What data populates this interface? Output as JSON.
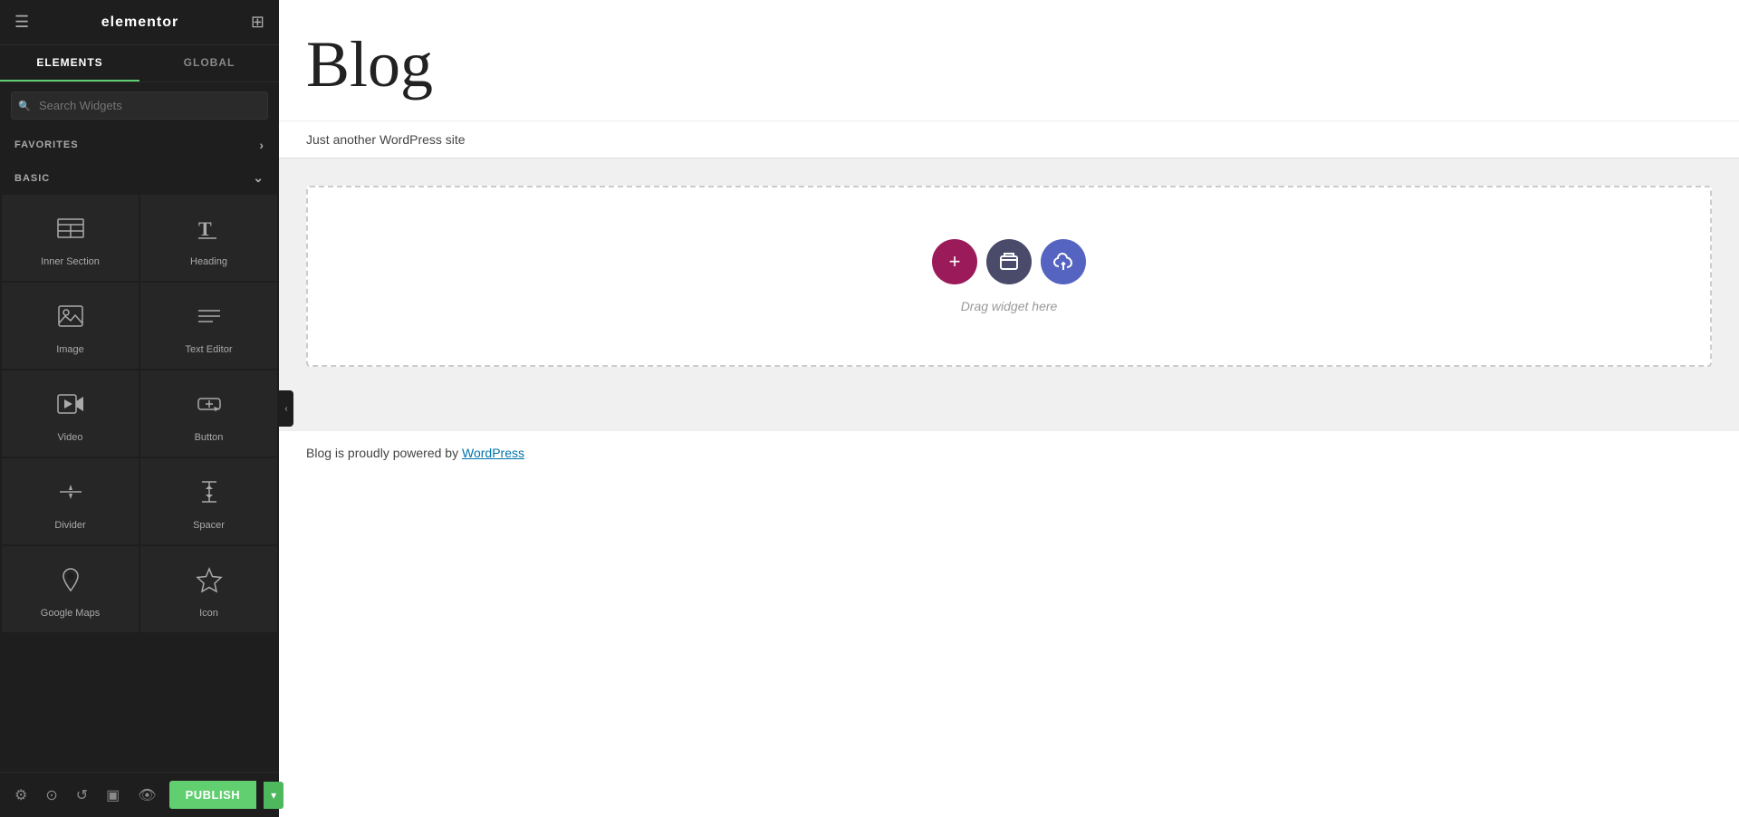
{
  "sidebar": {
    "logo": "elementor",
    "menu_icon": "☰",
    "grid_icon": "⊞",
    "tabs": [
      {
        "id": "elements",
        "label": "ELEMENTS",
        "active": true
      },
      {
        "id": "global",
        "label": "GLOBAL",
        "active": false
      }
    ],
    "search_placeholder": "Search Widgets",
    "sections": [
      {
        "id": "favorites",
        "label": "FAVORITES",
        "collapsed": false,
        "arrow": "›"
      },
      {
        "id": "basic",
        "label": "BASIC",
        "collapsed": false,
        "arrow": "⌄"
      }
    ],
    "widgets": [
      {
        "id": "inner-section",
        "label": "Inner Section",
        "icon": "inner-section"
      },
      {
        "id": "heading",
        "label": "Heading",
        "icon": "heading"
      },
      {
        "id": "image",
        "label": "Image",
        "icon": "image"
      },
      {
        "id": "text-editor",
        "label": "Text Editor",
        "icon": "text-editor"
      },
      {
        "id": "video",
        "label": "Video",
        "icon": "video"
      },
      {
        "id": "button",
        "label": "Button",
        "icon": "button"
      },
      {
        "id": "divider",
        "label": "Divider",
        "icon": "divider"
      },
      {
        "id": "spacer",
        "label": "Spacer",
        "icon": "spacer"
      },
      {
        "id": "google-maps",
        "label": "Google Maps",
        "icon": "google-maps"
      },
      {
        "id": "icon",
        "label": "Icon",
        "icon": "icon"
      }
    ],
    "bottom": {
      "settings_label": "Settings",
      "layers_label": "Layers",
      "history_label": "History",
      "responsive_label": "Responsive",
      "eye_label": "Eye",
      "publish_label": "PUBLISH",
      "publish_arrow": "▾"
    }
  },
  "canvas": {
    "blog_title": "Blog",
    "subtitle": "Just another WordPress site",
    "drop_zone_hint": "Drag widget here",
    "footer_text": "Blog is proudly powered by ",
    "footer_link": "WordPress",
    "footer_link_url": "#"
  },
  "colors": {
    "accent_green": "#61CE70",
    "btn_add": "#9B1B5A",
    "btn_folder": "#4a4a6a",
    "btn_cloud": "#5563c1"
  }
}
